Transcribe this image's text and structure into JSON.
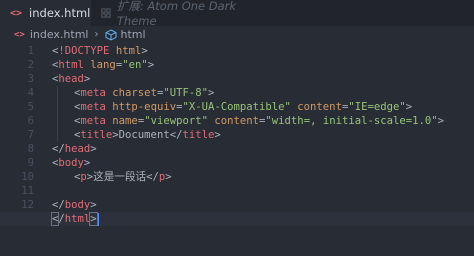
{
  "tabs": [
    {
      "icon": "html-icon",
      "label": "index.html",
      "active": true
    },
    {
      "icon": "theme-icon",
      "label": "扩展: Atom One Dark Theme",
      "active": false
    }
  ],
  "breadcrumb": {
    "file_icon_text": "<>",
    "file": "index.html",
    "separator": "›",
    "symbol": "html"
  },
  "editor": {
    "current_line": 13,
    "line_numbers": [
      "1",
      "2",
      "3",
      "4",
      "5",
      "6",
      "7",
      "8",
      "9",
      "10",
      "11",
      "12",
      "13"
    ]
  },
  "colors": {
    "background": "#282c34",
    "tag": "#e06c75",
    "attribute": "#d19a66",
    "string": "#98c379",
    "text": "#abb2bf"
  }
}
